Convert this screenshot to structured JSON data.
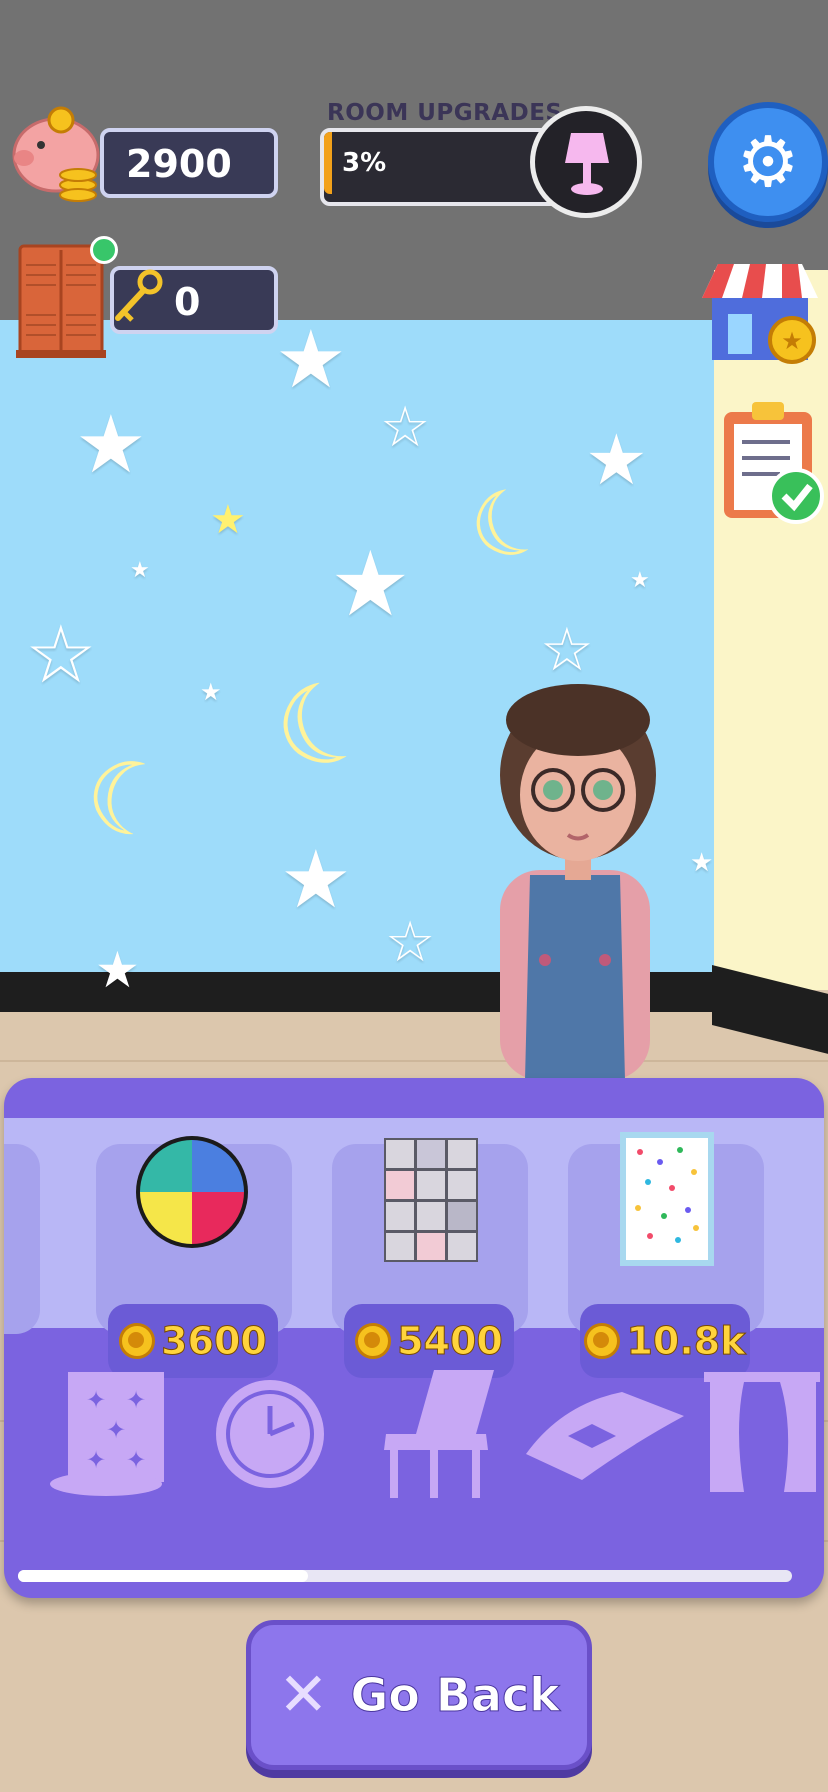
{
  "hud": {
    "coins": "2900",
    "keys": "0",
    "room_upgrades_title": "ROOM UPGRADES",
    "room_upgrades_progress": "3%",
    "room_upgrades_fraction": 0.03
  },
  "shop": {
    "items": [
      {
        "name": "puzzle-rug",
        "price": "3600"
      },
      {
        "name": "patchwork-rug",
        "price": "5400"
      },
      {
        "name": "confetti-rug",
        "price": "10.8k"
      }
    ],
    "categories": [
      "wallpaper-icon",
      "clock-icon",
      "chair-icon",
      "rug-icon",
      "curtain-icon"
    ]
  },
  "actions": {
    "go_back_label": "Go Back"
  },
  "colors": {
    "panel": "#7b63e0",
    "panel_top": "#b9b7f6",
    "price_text": "#ffd43c",
    "wall": "#9edcfa",
    "ceiling": "#727272",
    "settings_button": "#3e8ff0"
  }
}
